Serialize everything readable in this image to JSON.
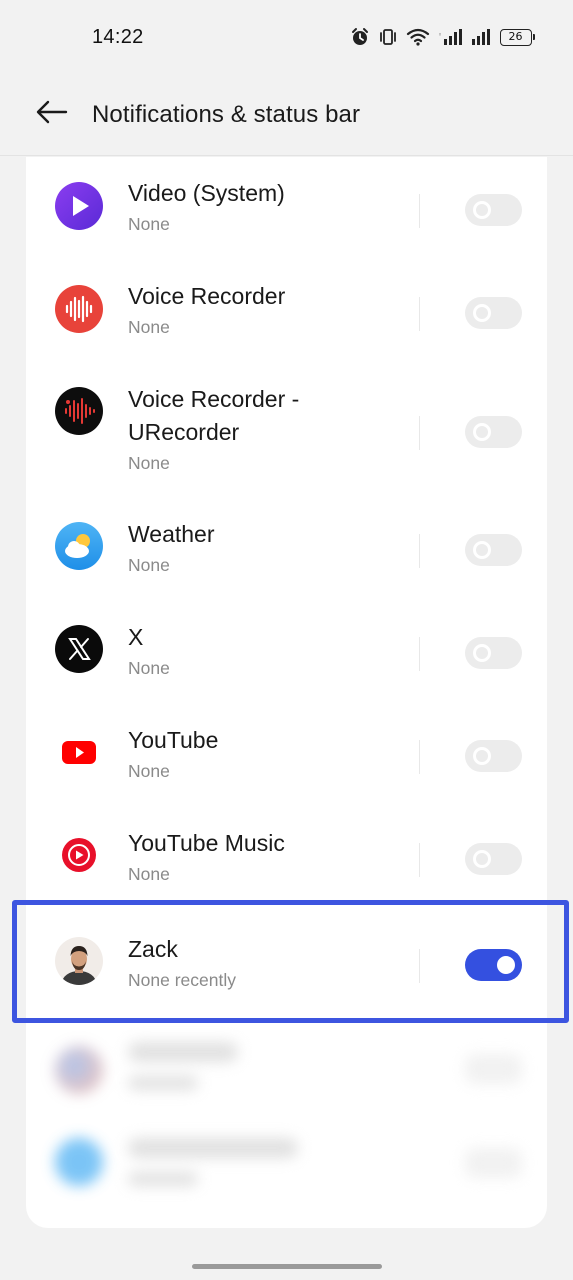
{
  "status_bar": {
    "time": "14:22",
    "battery": "26",
    "icons": [
      "alarm-icon",
      "vibrate-icon",
      "wifi-icon",
      "signal-icon",
      "signal-icon"
    ]
  },
  "header": {
    "title": "Notifications & status bar",
    "back_icon": "back-arrow-icon"
  },
  "apps": [
    {
      "name": "Video (System)",
      "sub": "None",
      "enabled": false,
      "icon": "video-play-icon"
    },
    {
      "name": "Voice Recorder",
      "sub": "None",
      "enabled": false,
      "icon": "voice-recorder-icon"
    },
    {
      "name_line1": "Voice Recorder -",
      "name_line2": "URecorder",
      "sub": "None",
      "enabled": false,
      "icon": "urecorder-icon"
    },
    {
      "name": "Weather",
      "sub": "None",
      "enabled": false,
      "icon": "weather-icon"
    },
    {
      "name": "X",
      "sub": "None",
      "enabled": false,
      "icon": "x-logo-icon"
    },
    {
      "name": "YouTube",
      "sub": "None",
      "enabled": false,
      "icon": "youtube-icon"
    },
    {
      "name": "YouTube Music",
      "sub": "None",
      "enabled": false,
      "icon": "youtube-music-icon"
    },
    {
      "name": "Zack",
      "sub": "None recently",
      "enabled": true,
      "icon": "avatar"
    }
  ],
  "colors": {
    "accent": "#3450e0",
    "highlight": "#3d55e0",
    "background": "#f2f2f2",
    "card": "#ffffff"
  }
}
